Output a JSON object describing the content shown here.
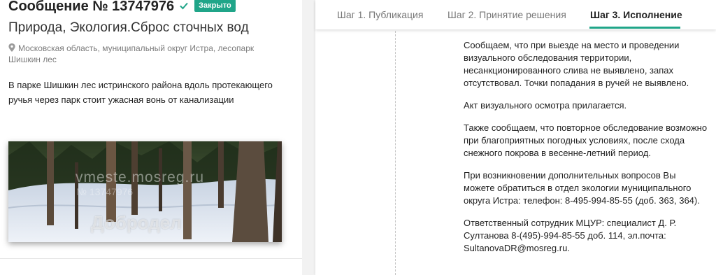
{
  "message": {
    "title": "Сообщение № 13747976",
    "status_badge": "Закрыто",
    "category": "Природа, Экология.Сброс сточных вод",
    "location": "Московская область, муниципальный округ Истра, лесопарк Шишкин лес",
    "description": "В парке Шишкин лес истринского района вдоль протекающего ручья через парк стоит ужасная вонь от канализации"
  },
  "photo": {
    "watermark_site": "vmeste.mosreg.ru",
    "watermark_number": "№ 13747976",
    "watermark_brand": "Добродел"
  },
  "tabs": [
    {
      "label": "Шаг 1. Публикация"
    },
    {
      "label": "Шаг 2. Принятие решения"
    },
    {
      "label": "Шаг 3. Исполнение",
      "active": true
    }
  ],
  "response": {
    "p1": "Сообщаем, что при выезде на место и проведении визуального обследования территории, несанкционированного слива не выявлено, запах отсутствовал. Точки попадания в ручей не выявлено.",
    "p2": "Акт визуального осмотра прилагается.",
    "p3": "Также сообщаем, что повторное обследование возможно при благоприятных погодных условиях, после схода снежного покрова в весенне-летний период.",
    "p4": "При возникновении дополнительных вопросов Вы можете обратиться в отдел экологии муниципального округа Истра: телефон: 8-495-994-85-55 (доб. 363, 364).",
    "p5": "Ответственный сотрудник МЦУР: специалист Д. Р. Султанова 8-(495)-994-85-55 доб. 114, эл.почта: SultanovaDR@mosreg.ru."
  },
  "colors": {
    "accent": "#20a589",
    "muted_text": "#7c7c7c"
  },
  "icons": {
    "verified": "check-icon",
    "location": "map-pin-icon"
  }
}
